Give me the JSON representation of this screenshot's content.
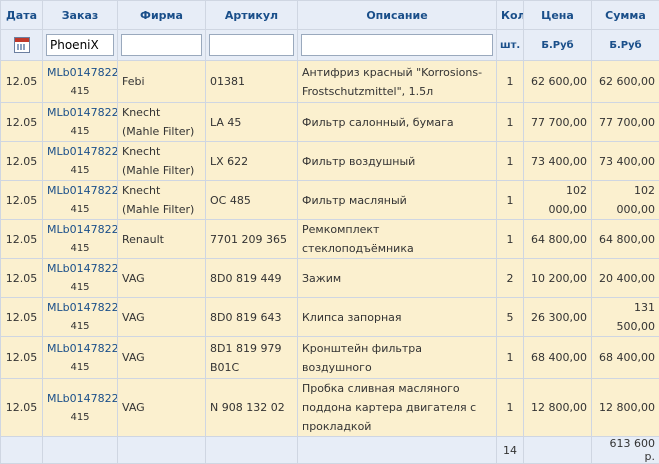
{
  "headers": {
    "date": "Дата",
    "order": "Заказ",
    "brand": "Фирма",
    "article": "Артикул",
    "description": "Описание",
    "qty": "Кол",
    "price": "Цена",
    "sum": "Сумма"
  },
  "filters": {
    "order_value": "PhoeniX",
    "brand_value": "",
    "article_value": "",
    "description_value": "",
    "qty_unit": "шт.",
    "price_unit": "Б.Руб",
    "sum_unit": "Б.Руб",
    "calendar_icon": "calendar-icon"
  },
  "rows": [
    {
      "date": "12.05",
      "order": "MLb0147822",
      "order_num": "415",
      "brand": "Febi",
      "article": "01381",
      "description": "Антифриз красный \"Korrosions-Frostschutzmittel\", 1.5л",
      "qty": "1",
      "price": "62 600,00",
      "sum": "62 600,00"
    },
    {
      "date": "12.05",
      "order": "MLb0147822",
      "order_num": "415",
      "brand": "Knecht (Mahle Filter)",
      "article": "LA 45",
      "description": "Фильтр салонный, бумага",
      "qty": "1",
      "price": "77 700,00",
      "sum": "77 700,00"
    },
    {
      "date": "12.05",
      "order": "MLb0147822",
      "order_num": "415",
      "brand": "Knecht (Mahle Filter)",
      "article": "LX 622",
      "description": "Фильтр воздушный",
      "qty": "1",
      "price": "73 400,00",
      "sum": "73 400,00"
    },
    {
      "date": "12.05",
      "order": "MLb0147822",
      "order_num": "415",
      "brand": "Knecht (Mahle Filter)",
      "article": "OC 485",
      "description": "Фильтр масляный",
      "qty": "1",
      "price": "102 000,00",
      "sum": "102 000,00"
    },
    {
      "date": "12.05",
      "order": "MLb0147822",
      "order_num": "415",
      "brand": "Renault",
      "article": "7701 209 365",
      "description": "Ремкомплект стеклоподъёмника",
      "qty": "1",
      "price": "64 800,00",
      "sum": "64 800,00"
    },
    {
      "date": "12.05",
      "order": "MLb0147822",
      "order_num": "415",
      "brand": "VAG",
      "article": "8D0 819 449",
      "description": "Зажим",
      "qty": "2",
      "price": "10 200,00",
      "sum": "20 400,00"
    },
    {
      "date": "12.05",
      "order": "MLb0147822",
      "order_num": "415",
      "brand": "VAG",
      "article": "8D0 819 643",
      "description": "Клипса запорная",
      "qty": "5",
      "price": "26 300,00",
      "sum": "131 500,00"
    },
    {
      "date": "12.05",
      "order": "MLb0147822",
      "order_num": "415",
      "brand": "VAG",
      "article": "8D1 819 979 B01C",
      "description": "Кронштейн фильтра воздушного",
      "qty": "1",
      "price": "68 400,00",
      "sum": "68 400,00"
    },
    {
      "date": "12.05",
      "order": "MLb0147822",
      "order_num": "415",
      "brand": "VAG",
      "article": "N 908 132 02",
      "description": "Пробка сливная масляного поддона картера двигателя с прокладкой",
      "qty": "1",
      "price": "12 800,00",
      "sum": "12 800,00"
    }
  ],
  "totals": {
    "qty": "14",
    "sum": "613 600 р."
  }
}
